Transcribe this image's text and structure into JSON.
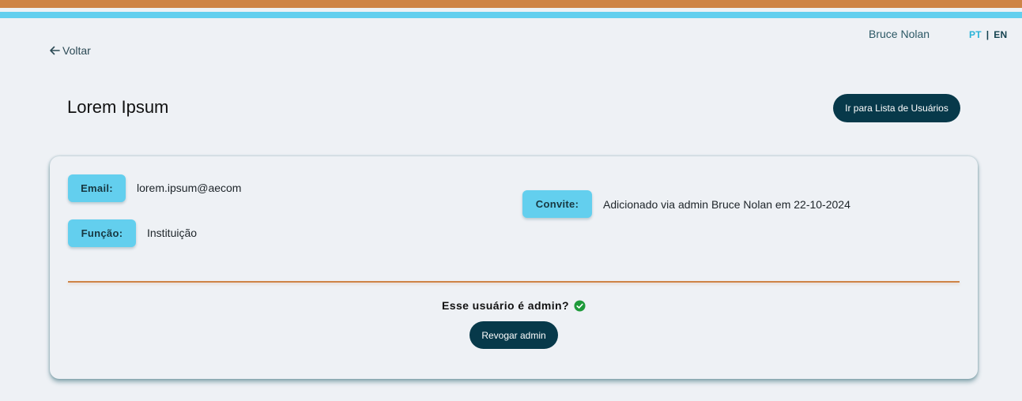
{
  "header": {
    "user_name": "Bruce Nolan",
    "lang_pt": "PT",
    "lang_separator": "|",
    "lang_en": "EN",
    "active_lang": "PT"
  },
  "nav": {
    "back_label": "Voltar",
    "back_icon": "arrow-left-icon"
  },
  "page": {
    "title": "Lorem Ipsum",
    "user_list_button": "Ir para Lista de Usuários"
  },
  "details": {
    "email_label": "Email:",
    "email_value": "lorem.ipsum@aecom",
    "role_label": "Função:",
    "role_value": "Instituição",
    "invite_label": "Convite:",
    "invite_value": "Adicionado via admin Bruce Nolan em 22-10-2024"
  },
  "admin": {
    "question": "Esse usuário é admin?",
    "status_icon": "check-circle-icon",
    "is_admin": true,
    "revoke_button": "Revogar admin"
  },
  "colors": {
    "accent_orange": "#CE8446",
    "accent_blue": "#63CFEE",
    "button_dark": "#07394A",
    "success_green": "#1E9A3A",
    "background": "#EEF1F5"
  }
}
